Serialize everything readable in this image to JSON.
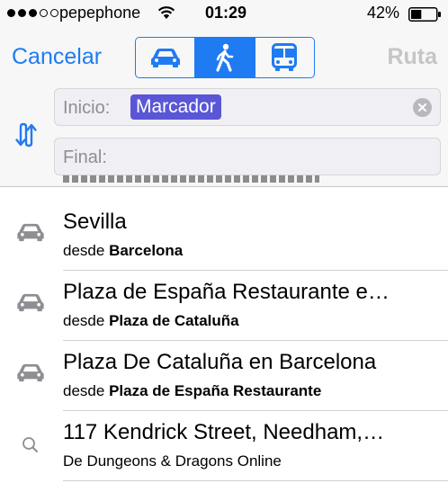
{
  "status_bar": {
    "carrier": "pepephone",
    "time": "01:29",
    "battery_percent": "42%",
    "signal_bars_filled": 3,
    "signal_bars_total": 5,
    "battery_level": 0.42
  },
  "nav": {
    "cancel_label": "Cancelar",
    "route_label": "Ruta",
    "transport_modes": [
      {
        "icon": "car-icon",
        "active": false
      },
      {
        "icon": "walk-icon",
        "active": true
      },
      {
        "icon": "bus-icon",
        "active": false
      }
    ]
  },
  "fields": {
    "start_label": "Inicio:",
    "start_value": "Marcador",
    "end_label": "Final:",
    "end_value": ""
  },
  "results": [
    {
      "icon": "car-icon",
      "title": "Sevilla",
      "sub_prefix": "desde",
      "sub_bold": "Barcelona",
      "sub_plain": ""
    },
    {
      "icon": "car-icon",
      "title": "Plaza de España Restaurante e…",
      "sub_prefix": "desde",
      "sub_bold": "Plaza de Cataluña",
      "sub_plain": ""
    },
    {
      "icon": "car-icon",
      "title": "Plaza De Cataluña en Barcelona",
      "sub_prefix": "desde",
      "sub_bold": "Plaza de España Restaurante",
      "sub_plain": ""
    },
    {
      "icon": "search-icon",
      "title": "117 Kendrick Street, Needham,…",
      "sub_prefix": "",
      "sub_bold": "",
      "sub_plain": "De Dungeons & Dragons Online"
    }
  ],
  "colors": {
    "accent": "#1f7bf2",
    "token_bg": "#5a56d6",
    "route_disabled": "#c5c5c7"
  }
}
